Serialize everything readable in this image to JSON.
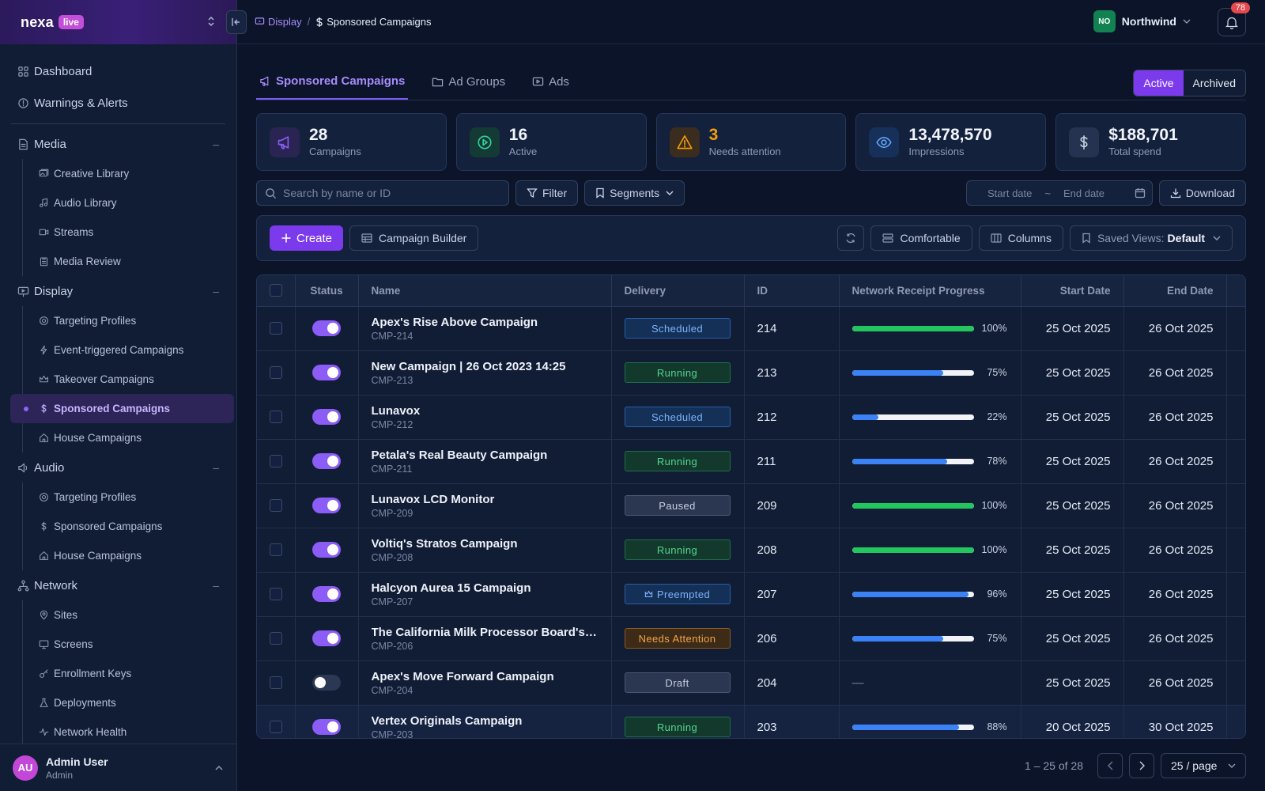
{
  "brand": {
    "name": "nexa",
    "badge": "live"
  },
  "sidebar": {
    "top_items": [
      {
        "label": "Dashboard",
        "icon": "grid-icon"
      },
      {
        "label": "Warnings & Alerts",
        "icon": "alert-circle-icon"
      }
    ],
    "groups": [
      {
        "label": "Media",
        "icon": "document-icon",
        "collapse": "–",
        "items": [
          {
            "label": "Creative Library",
            "icon": "images-icon"
          },
          {
            "label": "Audio Library",
            "icon": "music-note-icon"
          },
          {
            "label": "Streams",
            "icon": "video-icon"
          },
          {
            "label": "Media Review",
            "icon": "clipboard-icon"
          }
        ]
      },
      {
        "label": "Display",
        "icon": "display-icon",
        "collapse": "–",
        "items": [
          {
            "label": "Targeting Profiles",
            "icon": "target-icon"
          },
          {
            "label": "Event-triggered Campaigns",
            "icon": "lightning-icon"
          },
          {
            "label": "Takeover Campaigns",
            "icon": "crown-icon"
          },
          {
            "label": "Sponsored Campaigns",
            "icon": "dollar-icon",
            "active": true
          },
          {
            "label": "House Campaigns",
            "icon": "house-icon"
          }
        ]
      },
      {
        "label": "Audio",
        "icon": "speaker-icon",
        "collapse": "–",
        "items": [
          {
            "label": "Targeting Profiles",
            "icon": "target-icon"
          },
          {
            "label": "Sponsored Campaigns",
            "icon": "dollar-icon"
          },
          {
            "label": "House Campaigns",
            "icon": "house-icon"
          }
        ]
      },
      {
        "label": "Network",
        "icon": "network-icon",
        "collapse": "–",
        "items": [
          {
            "label": "Sites",
            "icon": "map-pin-icon"
          },
          {
            "label": "Screens",
            "icon": "monitor-icon"
          },
          {
            "label": "Enrollment Keys",
            "icon": "key-icon"
          },
          {
            "label": "Deployments",
            "icon": "flask-icon"
          },
          {
            "label": "Network Health",
            "icon": "pulse-icon"
          }
        ]
      }
    ]
  },
  "user": {
    "initials": "AU",
    "name": "Admin User",
    "role": "Admin"
  },
  "topbar": {
    "breadcrumb_parent": "Display",
    "breadcrumb_current": "Sponsored Campaigns",
    "org_initials": "NO",
    "org_name": "Northwind",
    "notification_count": "78"
  },
  "tabs": [
    {
      "label": "Sponsored Campaigns",
      "icon": "megaphone-icon",
      "active": true
    },
    {
      "label": "Ad Groups",
      "icon": "folder-icon"
    },
    {
      "label": "Ads",
      "icon": "ad-icon"
    }
  ],
  "scope_toggle": {
    "active": "Active",
    "archived": "Archived"
  },
  "stats": [
    {
      "value": "28",
      "label": "Campaigns",
      "icon": "megaphone-icon",
      "color": "#8b5cf6",
      "bg": "#2a2452"
    },
    {
      "value": "16",
      "label": "Active",
      "icon": "play-circle-icon",
      "color": "#34d399",
      "bg": "#133a34"
    },
    {
      "value": "3",
      "label": "Needs attention",
      "icon": "warning-icon",
      "color": "#f59e0b",
      "bg": "#3a2c1e",
      "value_color": "#f59e0b"
    },
    {
      "value": "13,478,570",
      "label": "Impressions",
      "icon": "eye-icon",
      "color": "#60a5fa",
      "bg": "#16305a"
    },
    {
      "value": "$188,701",
      "label": "Total spend",
      "icon": "dollar-icon",
      "color": "#c9d3e6",
      "bg": "#263350"
    }
  ],
  "toolbar": {
    "search_placeholder": "Search by name or ID",
    "filter_label": "Filter",
    "segments_label": "Segments",
    "start_date_placeholder": "Start date",
    "date_separator": "~",
    "end_date_placeholder": "End date",
    "download_label": "Download"
  },
  "actions": {
    "create_label": "Create",
    "builder_label": "Campaign Builder",
    "density_label": "Comfortable",
    "columns_label": "Columns",
    "saved_views_label": "Saved Views:",
    "saved_views_value": "Default"
  },
  "table": {
    "headers": {
      "status": "Status",
      "name": "Name",
      "delivery": "Delivery",
      "id": "ID",
      "progress": "Network Receipt Progress",
      "start": "Start Date",
      "end": "End Date"
    },
    "rows": [
      {
        "on": true,
        "name": "Apex's Rise Above Campaign",
        "code": "CMP-214",
        "delivery": "Scheduled",
        "delivery_kind": "scheduled",
        "id": "214",
        "progress": 100,
        "progress_label": "100%",
        "start": "25 Oct 2025",
        "end": "26 Oct 2025"
      },
      {
        "on": true,
        "name": "New Campaign | 26 Oct 2023 14:25",
        "code": "CMP-213",
        "delivery": "Running",
        "delivery_kind": "running",
        "id": "213",
        "progress": 75,
        "progress_label": "75%",
        "start": "25 Oct 2025",
        "end": "26 Oct 2025"
      },
      {
        "on": true,
        "name": "Lunavox",
        "code": "CMP-212",
        "delivery": "Scheduled",
        "delivery_kind": "scheduled",
        "id": "212",
        "progress": 22,
        "progress_label": "22%",
        "start": "25 Oct 2025",
        "end": "26 Oct 2025"
      },
      {
        "on": true,
        "name": "Petala's Real Beauty Campaign",
        "code": "CMP-211",
        "delivery": "Running",
        "delivery_kind": "running",
        "id": "211",
        "progress": 78,
        "progress_label": "78%",
        "start": "25 Oct 2025",
        "end": "26 Oct 2025"
      },
      {
        "on": true,
        "name": "Lunavox LCD Monitor",
        "code": "CMP-209",
        "delivery": "Paused",
        "delivery_kind": "paused",
        "id": "209",
        "progress": 100,
        "progress_label": "100%",
        "start": "25 Oct 2025",
        "end": "26 Oct 2025"
      },
      {
        "on": true,
        "name": "Voltiq's Stratos Campaign",
        "code": "CMP-208",
        "delivery": "Running",
        "delivery_kind": "running",
        "id": "208",
        "progress": 100,
        "progress_label": "100%",
        "start": "25 Oct 2025",
        "end": "26 Oct 2025"
      },
      {
        "on": true,
        "name": "Halcyon Aurea 15 Campaign",
        "code": "CMP-207",
        "delivery": "Preempted",
        "delivery_kind": "preempted",
        "id": "207",
        "progress": 96,
        "progress_label": "96%",
        "start": "25 Oct 2025",
        "end": "26 Oct 2025"
      },
      {
        "on": true,
        "name": "The California Milk Processor Board's Pu...",
        "code": "CMP-206",
        "delivery": "Needs Attention",
        "delivery_kind": "attention",
        "id": "206",
        "progress": 75,
        "progress_label": "75%",
        "start": "25 Oct 2025",
        "end": "26 Oct 2025"
      },
      {
        "on": false,
        "name": "Apex's Move Forward Campaign",
        "code": "CMP-204",
        "delivery": "Draft",
        "delivery_kind": "draft",
        "id": "204",
        "progress": null,
        "progress_label": "—",
        "start": "25 Oct 2025",
        "end": "26 Oct 2025"
      },
      {
        "on": true,
        "name": "Vertex Originals Campaign",
        "code": "CMP-203",
        "delivery": "Running",
        "delivery_kind": "running",
        "id": "203",
        "progress": 88,
        "progress_label": "88%",
        "start": "20 Oct 2025",
        "end": "30 Oct 2025"
      }
    ]
  },
  "pagination": {
    "range": "1 – 25 of 28",
    "page_size": "25 / page"
  },
  "colors": {
    "accent": "#7c3aed",
    "progress_complete": "#22c55e",
    "progress_partial": "#3b82f6"
  }
}
